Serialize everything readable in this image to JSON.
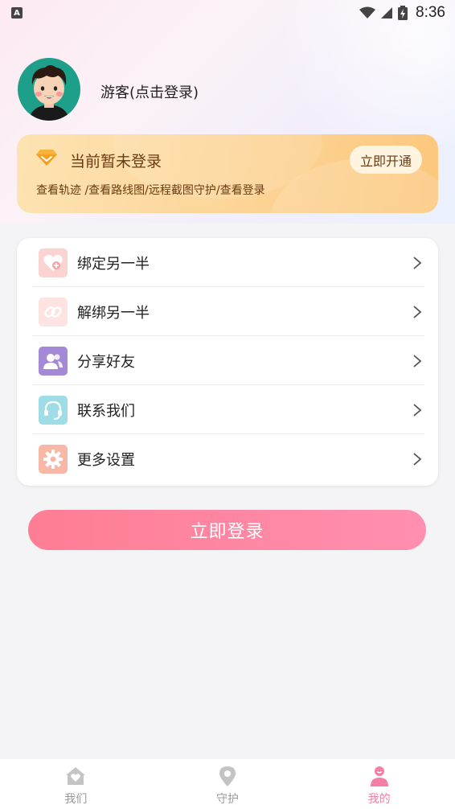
{
  "status_bar": {
    "time": "8:36",
    "left_icon": "A"
  },
  "profile": {
    "username": "游客(点击登录)"
  },
  "vip_card": {
    "title": "当前暂未登录",
    "description": "查看轨迹 /查看路线图/远程截图守护/查看登录",
    "button_label": "立即开通"
  },
  "menu": {
    "items": [
      {
        "label": "绑定另一半",
        "icon": "heart-icon",
        "icon_bg": "#fbd3d0"
      },
      {
        "label": "解绑另一半",
        "icon": "unlink-icon",
        "icon_bg": "#fde3e2"
      },
      {
        "label": "分享好友",
        "icon": "users-icon",
        "icon_bg": "#a48ad6"
      },
      {
        "label": "联系我们",
        "icon": "headset-icon",
        "icon_bg": "#9fdde6"
      },
      {
        "label": "更多设置",
        "icon": "gear-icon",
        "icon_bg": "#f8b8a8"
      }
    ]
  },
  "login_button": {
    "label": "立即登录"
  },
  "bottom_nav": {
    "items": [
      {
        "label": "我们",
        "icon": "home-heart-icon"
      },
      {
        "label": "守护",
        "icon": "location-pin-icon"
      },
      {
        "label": "我的",
        "icon": "person-icon",
        "active": true
      }
    ]
  },
  "colors": {
    "accent_pink": "#f47ea6",
    "vip_gold": "#fcc77c",
    "text_brown": "#6a3a12"
  }
}
